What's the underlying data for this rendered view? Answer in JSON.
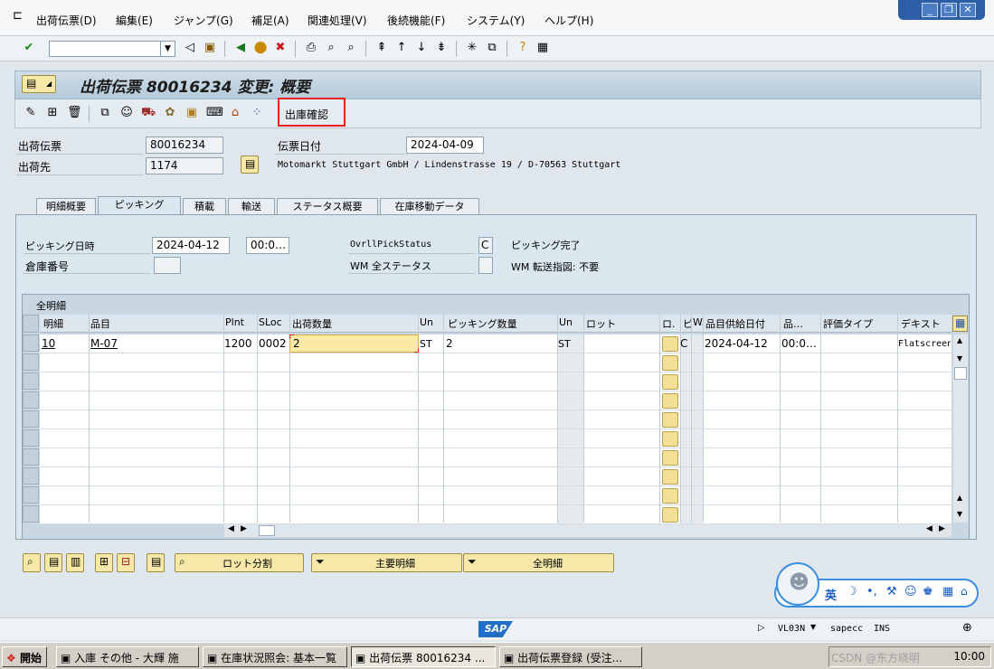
{
  "menu": {
    "items": [
      "出荷伝票(D)",
      "編集(E)",
      "ジャンプ(G)",
      "補足(A)",
      "関連処理(V)",
      "後続機能(F)",
      "システム(Y)",
      "ヘルプ(H)"
    ]
  },
  "window_controls": {
    "minimize": "_",
    "restore": "❐",
    "close": "✕"
  },
  "toolbar": {
    "command_field_value": ""
  },
  "title": "出荷伝票 80016234 変更: 概要",
  "app_toolbar": {
    "confirm_button": "出庫確認"
  },
  "header": {
    "delivery_label": "出荷伝票",
    "delivery_value": "80016234",
    "ship_to_label": "出荷先",
    "ship_to_value": "1174",
    "doc_date_label": "伝票日付",
    "doc_date_value": "2024-04-09",
    "address": "Motomarkt Stuttgart GmbH / Lindenstrasse 19 / D-70563 Stuttgart"
  },
  "tabs": [
    "明細概要",
    "ピッキング",
    "積載",
    "輸送",
    "ステータス概要",
    "在庫移動データ"
  ],
  "active_tab_index": 1,
  "picking": {
    "pick_datetime_label": "ピッキング日時",
    "pick_date": "2024-04-12",
    "pick_time": "00:0…",
    "warehouse_label": "倉庫番号",
    "warehouse_value": "",
    "overall_pick_status_label": "OvrllPickStatus",
    "overall_pick_status_value": "C",
    "overall_pick_status_text": "ピッキング完了",
    "wm_status_label": "WM 全ステータス",
    "wm_status_value": "",
    "wm_transfer_text": "WM 転送指図: 不要"
  },
  "table": {
    "title": "全明細",
    "columns": [
      "明細",
      "品目",
      "Plnt",
      "SLoc",
      "出荷数量",
      "Un",
      "ピッキング数量",
      "Un",
      "ロット",
      "ロ.",
      "ピ",
      "W.",
      "品目供給日付",
      "品…",
      "評価タイプ",
      "デキスト"
    ],
    "rows": [
      {
        "item": "10",
        "material": "M-07",
        "plant": "1200",
        "sloc": "0002",
        "delivery_qty": "2",
        "unit": "ST",
        "picked_qty": "2",
        "picked_unit": "ST",
        "batch": "",
        "pick_status": "C",
        "avail_date": "2024-04-12",
        "time": "00:0…",
        "valuation_type": "",
        "text": "Flatscreen"
      }
    ]
  },
  "bottom_buttons": {
    "batch_split": "ロット分割",
    "main_items": "主要明細",
    "all_items": "全明細"
  },
  "status_bar": {
    "sap_logo": "SAP",
    "transaction": "VL03N",
    "server": "sapecc",
    "mode": "INS"
  },
  "taskbar": {
    "start": "開始",
    "tasks": [
      "入庫 その他 - 大輝 施",
      "在庫状況照会: 基本一覧",
      "出荷伝票 80016234 ...",
      "出荷伝票登録 (受注..."
    ],
    "active_task_index": 2,
    "tray_text": "CSDN @东方晓明",
    "clock": "10:00"
  },
  "ime": {
    "lang": "英"
  }
}
